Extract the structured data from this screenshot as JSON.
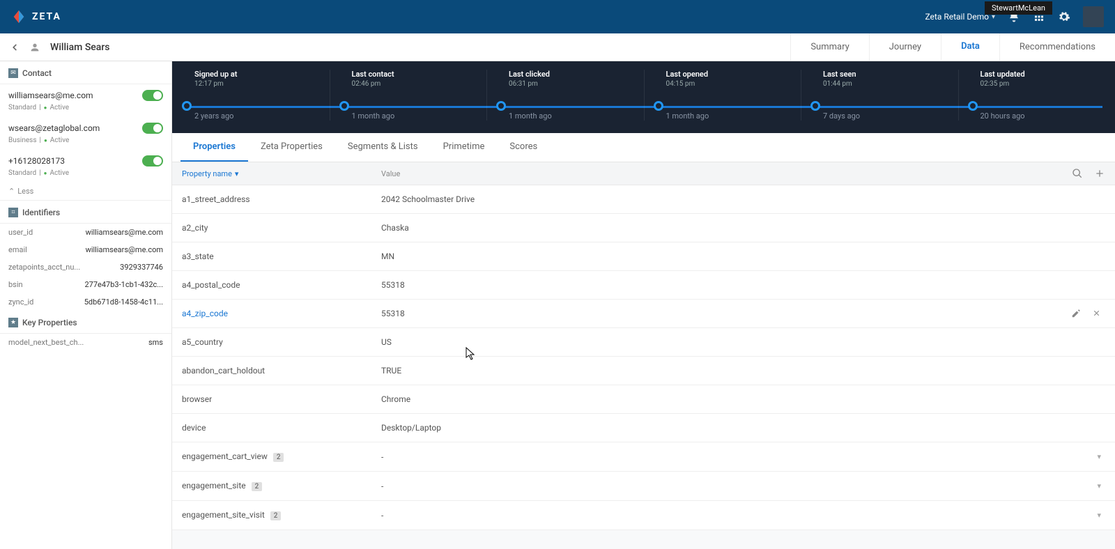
{
  "header": {
    "brand": "ZETA",
    "account_label": "Zeta Retail Demo",
    "user_badge": "StewartMcLean"
  },
  "profile": {
    "name": "William Sears"
  },
  "main_tabs": {
    "summary": "Summary",
    "journey": "Journey",
    "data": "Data",
    "recommendations": "Recommendations"
  },
  "sidebar": {
    "contact_head": "Contact",
    "contacts": [
      {
        "value": "williamsears@me.com",
        "type": "Standard",
        "status": "Active"
      },
      {
        "value": "wsears@zetaglobal.com",
        "type": "Business",
        "status": "Active"
      },
      {
        "value": "+16128028173",
        "type": "Standard",
        "status": "Active"
      }
    ],
    "less": "Less",
    "identifiers_head": "Identifiers",
    "identifiers": [
      {
        "k": "user_id",
        "v": "williamsears@me.com"
      },
      {
        "k": "email",
        "v": "williamsears@me.com"
      },
      {
        "k": "zetapoints_acct_nu...",
        "v": "3929337746"
      },
      {
        "k": "bsin",
        "v": "277e47b3-1cb1-432c..."
      },
      {
        "k": "zync_id",
        "v": "5db671d8-1458-4c11..."
      }
    ],
    "keyprops_head": "Key Properties",
    "keyprops": [
      {
        "k": "model_next_best_ch...",
        "v": "sms"
      }
    ]
  },
  "timeline": [
    {
      "label": "Signed up at",
      "time": "12:17 pm",
      "ago": "2 years ago"
    },
    {
      "label": "Last contact",
      "time": "02:46 pm",
      "ago": "1 month ago"
    },
    {
      "label": "Last clicked",
      "time": "06:31 pm",
      "ago": "1 month ago"
    },
    {
      "label": "Last opened",
      "time": "04:15 pm",
      "ago": "1 month ago"
    },
    {
      "label": "Last seen",
      "time": "01:44 pm",
      "ago": "7 days ago"
    },
    {
      "label": "Last updated",
      "time": "02:35 pm",
      "ago": "20 hours ago"
    }
  ],
  "sub_tabs": {
    "properties": "Properties",
    "zeta": "Zeta Properties",
    "segments": "Segments & Lists",
    "primetime": "Primetime",
    "scores": "Scores"
  },
  "prop_header": {
    "name_col": "Property name",
    "value_col": "Value"
  },
  "properties": [
    {
      "name": "a1_street_address",
      "value": "2042 Schoolmaster Drive"
    },
    {
      "name": "a2_city",
      "value": "Chaska"
    },
    {
      "name": "a3_state",
      "value": "MN"
    },
    {
      "name": "a4_postal_code",
      "value": "55318"
    },
    {
      "name": "a4_zip_code",
      "value": "55318",
      "hovered": true
    },
    {
      "name": "a5_country",
      "value": "US"
    },
    {
      "name": "abandon_cart_holdout",
      "value": "TRUE"
    },
    {
      "name": "browser",
      "value": "Chrome"
    },
    {
      "name": "device",
      "value": "Desktop/Laptop"
    },
    {
      "name": "engagement_cart_view",
      "value": "-",
      "badge": "2",
      "expandable": true
    },
    {
      "name": "engagement_site",
      "value": "-",
      "badge": "2",
      "expandable": true
    },
    {
      "name": "engagement_site_visit",
      "value": "-",
      "badge": "2",
      "expandable": true
    }
  ]
}
